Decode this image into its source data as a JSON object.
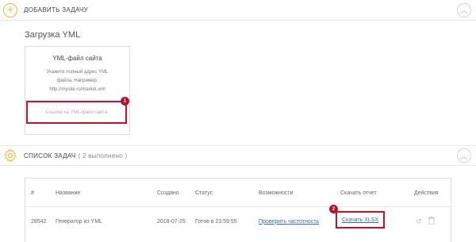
{
  "add_section": {
    "icon": "plus-circle-icon",
    "title": "ДОБАВИТЬ ЗАДАЧУ",
    "collapse_icon": "chevron-up-icon"
  },
  "yml_upload": {
    "title": "Загрузка YML",
    "card_title": "YML-файл сайта",
    "description_line1": "Укажите полный адрес YML",
    "description_line2": "файла. Например:",
    "description_line3": "http://mysite.ru/market.xml",
    "input_placeholder": "Ссылка на YML-файл сайта",
    "input_value": "",
    "badge": "1"
  },
  "tasks_section": {
    "icon": "gear-icon",
    "title": "СПИСОК ЗАДАЧ",
    "count": "( 2 выполнено )",
    "collapse_icon": "chevron-up-icon"
  },
  "table": {
    "columns": {
      "id": "#",
      "name": "Название",
      "created": "Создано",
      "status": "Статус",
      "features": "Возможности",
      "report": "Скачать отчет",
      "actions": "Действия"
    },
    "rows": [
      {
        "id": "28542",
        "name": "Генератор из YML",
        "created": "2018-07-25",
        "status": "Готов в 23:59:55",
        "features": "Проверить частотность",
        "report": "Скачать XLSX",
        "report_badge": "2",
        "action_icons": [
          "undo-icon",
          "trash-icon"
        ]
      }
    ]
  },
  "colors": {
    "accent": "#f0b63c",
    "highlight": "#c8102e",
    "badge": "#b0142b",
    "link": "#3a6ea8",
    "status_ok": "#7cb342"
  }
}
